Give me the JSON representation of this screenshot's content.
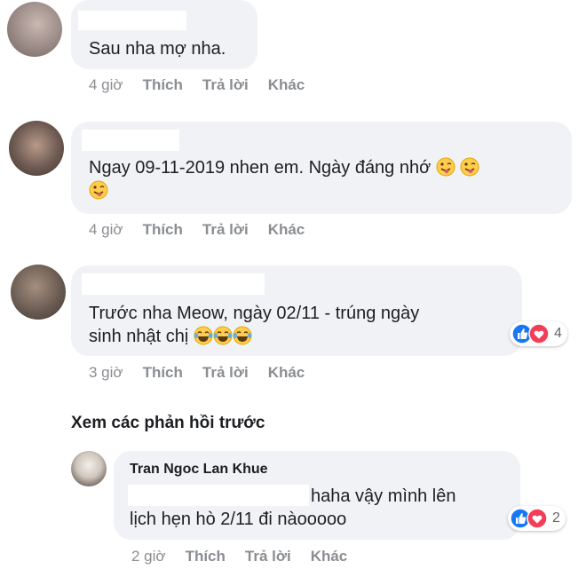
{
  "comments": [
    {
      "text": "Sau nha mợ nha.",
      "time": "4 giờ",
      "like": "Thích",
      "reply": "Trả lời",
      "other": "Khác"
    },
    {
      "text": "Ngay 09-11-2019 nhen em. Ngày đáng nhớ",
      "time": "4 giờ",
      "like": "Thích",
      "reply": "Trả lời",
      "other": "Khác"
    },
    {
      "text_line1": "Trước nha Meow, ngày 02/11 - trúng ngày",
      "text_line2": "sinh nhật chị",
      "time": "3 giờ",
      "like": "Thích",
      "reply": "Trả lời",
      "other": "Khác",
      "reactions": "4"
    }
  ],
  "view_previous": "Xem các phản hồi trước",
  "reply": {
    "author": "Tran Ngoc Lan Khue",
    "text_line1": "haha vậy mình lên",
    "text_line2": "lịch hẹn hò 2/11 đi nàooooo",
    "time": "2 giờ",
    "like": "Thích",
    "reply": "Trả lời",
    "other": "Khác",
    "reactions": "2"
  },
  "icons": [
    "wink-tongue-emoji",
    "laughing-tears-emoji",
    "like-reaction-icon",
    "love-reaction-icon"
  ],
  "colors": {
    "bubble": "#f0f2f5",
    "meta": "#8a8d91",
    "like": "#1877f2",
    "love": "#f33e58",
    "emoji": "#ffcc4d"
  }
}
